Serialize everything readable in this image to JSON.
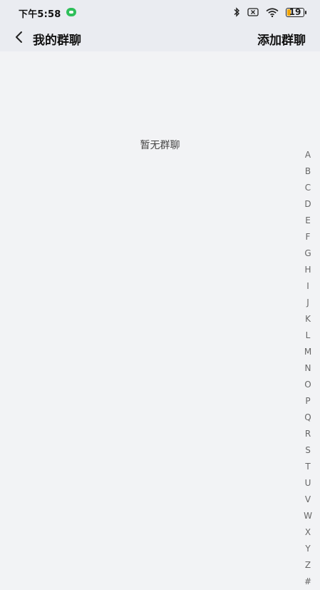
{
  "status_bar": {
    "time": "下午5:58",
    "battery": "19",
    "icons": [
      "bluetooth-icon",
      "sim-off-icon",
      "wifi-icon",
      "battery-icon"
    ]
  },
  "nav": {
    "back_icon": "chevron-left-icon",
    "title": "我的群聊",
    "action_label": "添加群聊"
  },
  "content": {
    "empty_text": "暂无群聊"
  },
  "index_bar": {
    "letters": [
      "A",
      "B",
      "C",
      "D",
      "E",
      "F",
      "G",
      "H",
      "I",
      "J",
      "K",
      "L",
      "M",
      "N",
      "O",
      "P",
      "Q",
      "R",
      "S",
      "T",
      "U",
      "V",
      "W",
      "X",
      "Y",
      "Z",
      "#"
    ]
  }
}
